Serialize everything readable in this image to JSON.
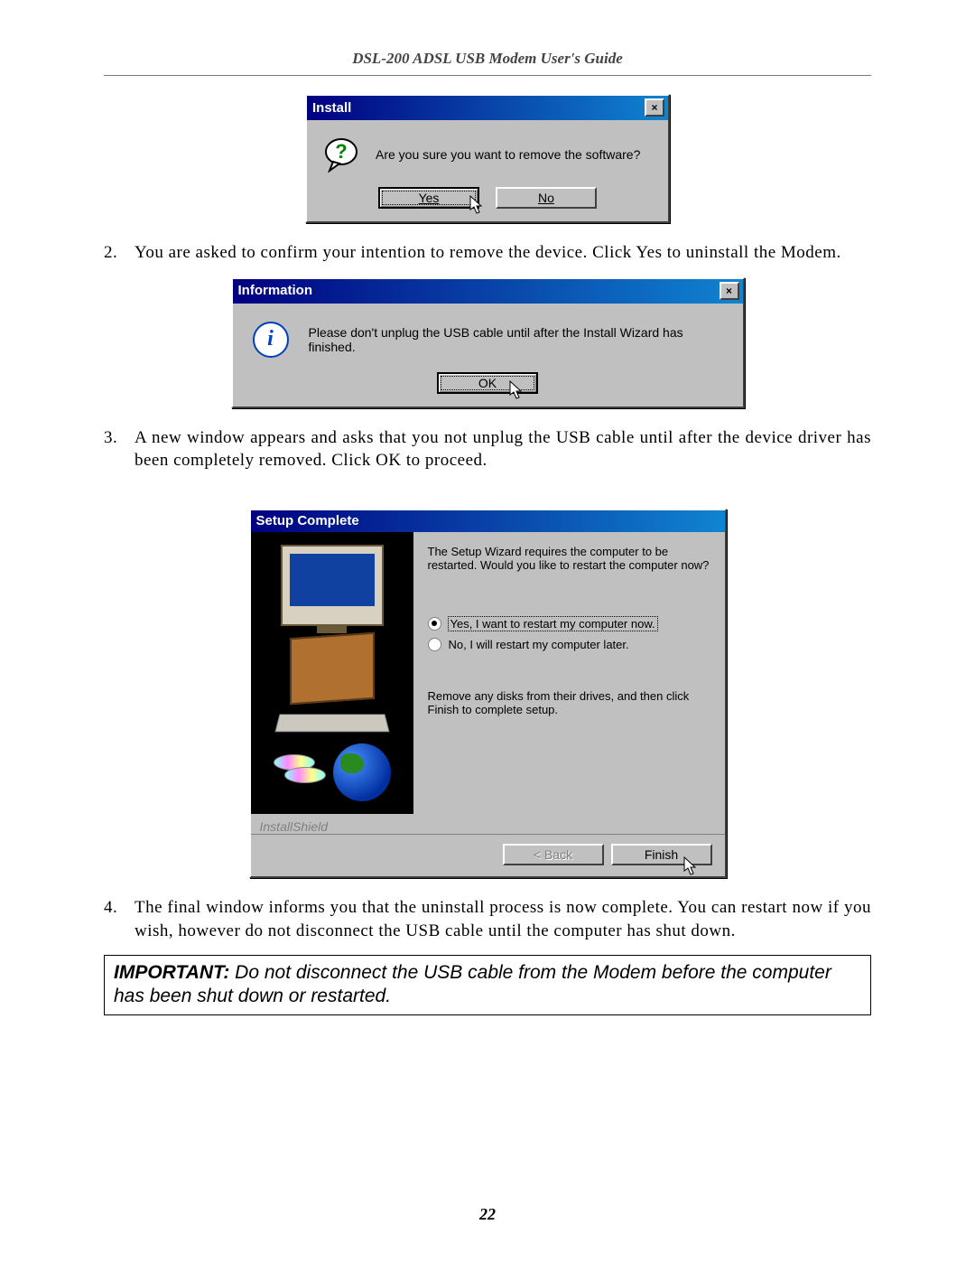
{
  "doc": {
    "header": "DSL-200 ADSL USB Modem User's Guide",
    "page_number": "22"
  },
  "dialog1": {
    "title": "Install",
    "message": "Are you sure you want to remove the software?",
    "yes": "Yes",
    "no": "No",
    "close_x": "×"
  },
  "step2": {
    "num": "2.",
    "text": "You are asked to confirm your intention to remove the device. Click Yes to uninstall the Modem."
  },
  "dialog2": {
    "title": "Information",
    "message": "Please don't unplug the USB cable until after the Install Wizard has finished.",
    "ok": "OK",
    "close_x": "×"
  },
  "step3": {
    "num": "3.",
    "text": "A new window appears and asks that you not unplug the USB cable until after the device driver has been completely removed. Click OK to proceed."
  },
  "dialog3": {
    "title": "Setup Complete",
    "lead": "The Setup Wizard requires the computer to be restarted.  Would you like to restart the computer now?",
    "opt_yes": "Yes, I want to restart my computer now.",
    "opt_no": "No, I will restart my computer later.",
    "trailer": "Remove any disks from their drives, and then click Finish to complete setup.",
    "brand": "InstallShield",
    "back": "< Back",
    "finish": "Finish"
  },
  "step4": {
    "num": "4.",
    "text": "The final window informs you that the uninstall process is now complete. You can restart now if you wish, however do not disconnect the USB cable until the computer has shut down."
  },
  "important": {
    "label": "IMPORTANT:",
    "text": " Do not disconnect the USB cable from the Modem before the computer has been shut down or restarted."
  }
}
